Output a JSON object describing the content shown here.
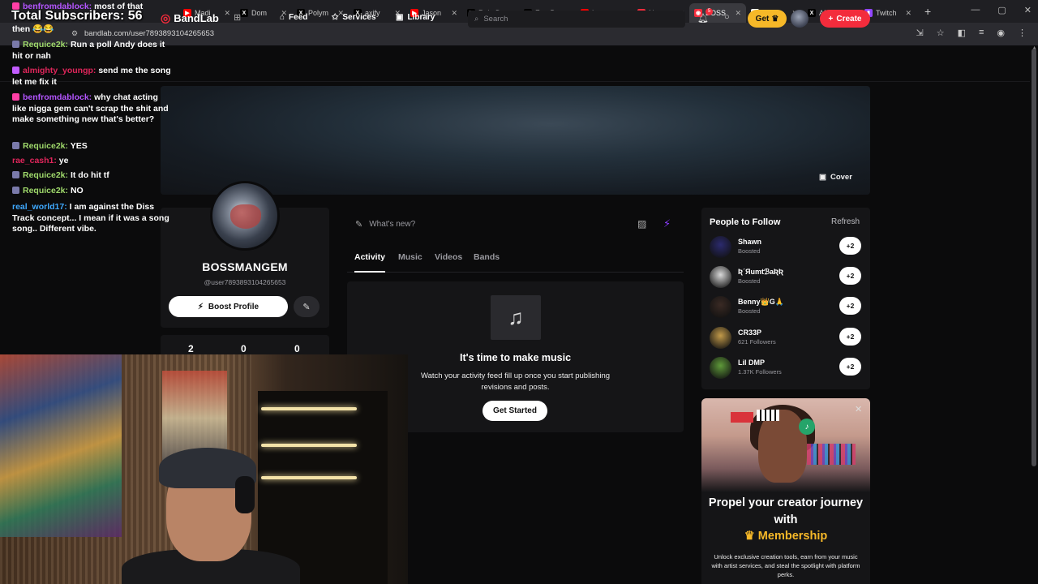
{
  "browser": {
    "tabs": [
      {
        "label": "Madi",
        "fav": "▶",
        "favcolor": "#ff0000",
        "active": false
      },
      {
        "label": "Dom",
        "fav": "X",
        "favcolor": "#000000",
        "active": false
      },
      {
        "label": "Polym",
        "fav": "X",
        "favcolor": "#000000",
        "active": false
      },
      {
        "label": "axify",
        "fav": "X",
        "favcolor": "#000000",
        "active": false
      },
      {
        "label": "Jason",
        "fav": "▶",
        "favcolor": "#ff0000",
        "active": false
      },
      {
        "label": "Rain D",
        "fav": "X",
        "favcolor": "#000000",
        "active": false
      },
      {
        "label": "FearB",
        "fav": "X",
        "favcolor": "#000000",
        "active": false
      },
      {
        "label": "Lacy",
        "fav": "▶",
        "favcolor": "#ff0000",
        "active": false
      },
      {
        "label": "Ne",
        "fav": "◉",
        "favcolor": "#f32c3c",
        "active": false
      },
      {
        "label": "BOSS",
        "fav": "◉",
        "favcolor": "#f32c3c",
        "active": true
      },
      {
        "label": "how",
        "fav": "G",
        "favcolor": "#ffffff",
        "active": false
      },
      {
        "label": "AMP",
        "fav": "X",
        "favcolor": "#000000",
        "active": false
      },
      {
        "label": "Twitch",
        "fav": "▮",
        "favcolor": "#9146ff",
        "active": false
      }
    ],
    "url": "bandlab.com/user7893893104265653"
  },
  "header": {
    "logo": "BandLab",
    "nav": [
      {
        "label": "Feed",
        "icon": "⌂"
      },
      {
        "label": "Services",
        "icon": "✩"
      },
      {
        "label": "Library",
        "icon": "▣"
      }
    ],
    "search_placeholder": "Search",
    "notification_count": "5",
    "get_label": "Get",
    "create_label": "Create"
  },
  "cover": {
    "button_label": "Cover"
  },
  "profile": {
    "name": "BOSSMANGEM",
    "handle": "@user7893893104265653",
    "boost_label": "Boost Profile",
    "stats": [
      "2",
      "0",
      "0"
    ]
  },
  "feed": {
    "composer_placeholder": "What's new?",
    "tabs": [
      "Activity",
      "Music",
      "Videos",
      "Bands"
    ],
    "empty_title": "It's time to make music",
    "empty_desc": "Watch your activity feed fill up once you start publishing revisions and posts.",
    "get_started": "Get Started"
  },
  "people": {
    "title": "People to Follow",
    "refresh": "Refresh",
    "list": [
      {
        "name": "Shawn",
        "sub": "Boosted",
        "color": "#2b2a6e"
      },
      {
        "name": "ƦˊЯumtℬaƦƦ",
        "sub": "Boosted",
        "color": "#d9d9d9"
      },
      {
        "name": "Benny👑G🙏",
        "sub": "Boosted",
        "color": "#3a2a24"
      },
      {
        "name": "CR33P",
        "sub": "621 Followers",
        "color": "#c29a4a"
      },
      {
        "name": "Lil DMP",
        "sub": "1.37K Followers",
        "color": "#5f9a3a"
      }
    ],
    "follow_label": "+2"
  },
  "ad": {
    "title": "Propel your creator journey with",
    "membership": "Membership",
    "desc": "Unlock exclusive creation tools, earn from your music with artist services, and steal the spotlight with platform perks."
  },
  "overlay": {
    "subscribers": "Total Subscribers: 56",
    "chat": [
      {
        "user": "benfromdablock:",
        "text": "most of that",
        "color": "#b455ff",
        "badge": "#ff3fa6"
      },
      {
        "user": "",
        "text": "then 😂😂",
        "color": "#fff",
        "badge": ""
      },
      {
        "user": "Requice2k:",
        "text": "Run a poll Andy does it hit or nah",
        "color": "#9fd96b",
        "badge": "#7a7aaa"
      },
      {
        "user": "almighty_youngp:",
        "text": "send me the song let me fix it",
        "color": "#e0265b",
        "badge": "#c25cff"
      },
      {
        "user": "benfromdablock:",
        "text": "why chat acting like nigga gem can't scrap the shit and make something new that's better?",
        "color": "#b455ff",
        "badge": "#ff3fa6"
      },
      {
        "user": "Requice2k:",
        "text": "YES",
        "color": "#9fd96b",
        "badge": "#7a7aaa"
      },
      {
        "user": "rae_cash1:",
        "text": "ye",
        "color": "#e0265b",
        "badge": ""
      },
      {
        "user": "Requice2k:",
        "text": "It do hit tf",
        "color": "#9fd96b",
        "badge": "#7a7aaa"
      },
      {
        "user": "Requice2k:",
        "text": "NO",
        "color": "#9fd96b",
        "badge": "#7a7aaa"
      },
      {
        "user": "real_world17:",
        "text": "I am against the Diss Track concept... I mean if it was a song song.. Different vibe.",
        "color": "#3fa9ff",
        "badge": ""
      }
    ]
  }
}
